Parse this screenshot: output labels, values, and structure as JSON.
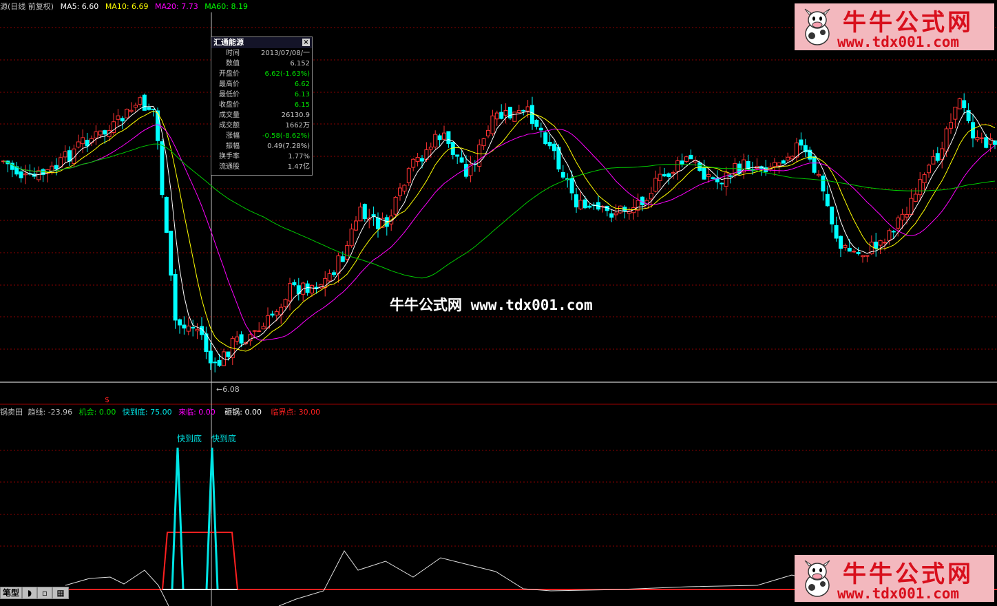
{
  "header": {
    "title": "源(日线 前复权)",
    "ma5": "MA5: 6.60",
    "ma10": "MA10: 6.69",
    "ma20": "MA20: 7.73",
    "ma60": "MA60: 8.19",
    "colors": {
      "title": "#c0c0c0",
      "ma5": "#ffffff",
      "ma10": "#ffff00",
      "ma20": "#ff00ff",
      "ma60": "#00ff00"
    }
  },
  "popup": {
    "title": "汇通能源",
    "close": "×",
    "rows": [
      {
        "label": "时间",
        "value": "2013/07/08/一",
        "color": "#c8c8c8"
      },
      {
        "label": "数值",
        "value": "6.152",
        "color": "#c8c8c8"
      },
      {
        "label": "开盘价",
        "value": "6.62(-1.63%)",
        "color": "#00e000"
      },
      {
        "label": "最高价",
        "value": "6.62",
        "color": "#00e000"
      },
      {
        "label": "最低价",
        "value": "6.13",
        "color": "#00e000"
      },
      {
        "label": "收盘价",
        "value": "6.15",
        "color": "#00e000"
      },
      {
        "label": "成交量",
        "value": "26130.9",
        "color": "#c8c8c8"
      },
      {
        "label": "成交额",
        "value": "1662万",
        "color": "#c8c8c8"
      },
      {
        "label": "涨幅",
        "value": "-0.58(-8.62%)",
        "color": "#00e000"
      },
      {
        "label": "振幅",
        "value": "0.49(7.28%)",
        "color": "#c8c8c8"
      },
      {
        "label": "换手率",
        "value": "1.77%",
        "color": "#c8c8c8"
      },
      {
        "label": "流通股",
        "value": "1.47亿",
        "color": "#c8c8c8"
      }
    ]
  },
  "min_price_label": "←6.08",
  "sell_marker": "$",
  "indicator": {
    "name": "锅卖田",
    "trend": "趋线: -23.96",
    "chance": "机会: 0.00",
    "near_bottom": "快到底: 75.00",
    "coming": "来临: 0.00",
    "smash": "砸锅: 0.00",
    "critical": "临界点: 30.00",
    "colors": {
      "name": "#c0c0c0",
      "trend": "#c0c0c0",
      "chance": "#00e000",
      "near_bottom": "#00e5e5",
      "coming": "#ff00ff",
      "smash": "#ffffff",
      "critical": "#ff2020"
    },
    "signal_labels": [
      "快到底",
      "快到底"
    ]
  },
  "watermark": "牛牛公式网 www.tdx001.com",
  "logo": {
    "text": "牛牛公式网",
    "url": "www.tdx001.com"
  },
  "toolbar": {
    "mode": "笔型",
    "b1": "◗",
    "b2": "▫",
    "b3": "▦"
  },
  "colors": {
    "up": "#ff3333",
    "down": "#00ffff",
    "grid": "#8b0000",
    "accent": "#d80f1c"
  }
}
